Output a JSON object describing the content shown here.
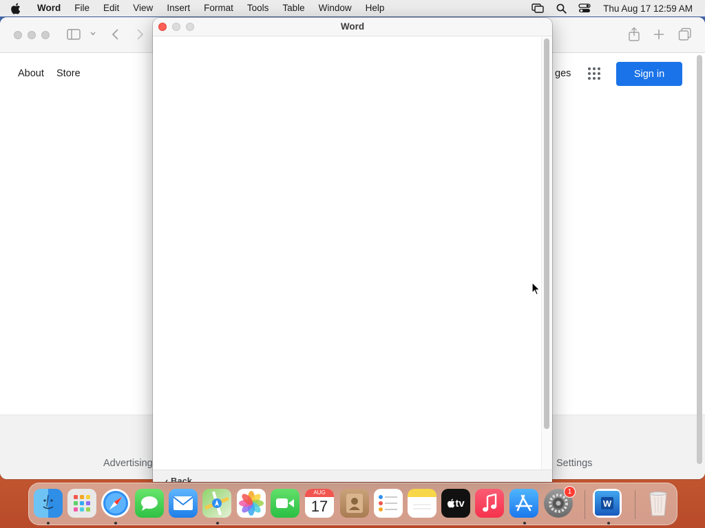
{
  "menubar": {
    "app_name": "Word",
    "items": [
      "File",
      "Edit",
      "View",
      "Insert",
      "Format",
      "Tools",
      "Table",
      "Window",
      "Help"
    ],
    "clock": "Thu Aug 17  12:59 AM"
  },
  "browser": {
    "nav_left": [
      "About",
      "Store"
    ],
    "nav_right_partial": "ges",
    "signin_label": "Sign in",
    "footer_left": "Advertising",
    "footer_right": "Settings"
  },
  "word_window": {
    "title": "Word",
    "bottom_label": "Back"
  },
  "dock": {
    "calendar_month": "AUG",
    "calendar_day": "17",
    "tv_label": "tv",
    "settings_badge": "1",
    "word_letter": "W",
    "apps": [
      "Finder",
      "Launchpad",
      "Safari",
      "Messages",
      "Mail",
      "Maps",
      "Photos",
      "FaceTime",
      "Calendar",
      "Contacts",
      "Reminders",
      "Notes",
      "TV",
      "Music",
      "App Store",
      "System Settings",
      "Microsoft Word",
      "Trash"
    ]
  },
  "colors": {
    "signin_blue": "#1a73e8",
    "close_red": "#ff5f57",
    "menubar_bg": "#ececec"
  }
}
